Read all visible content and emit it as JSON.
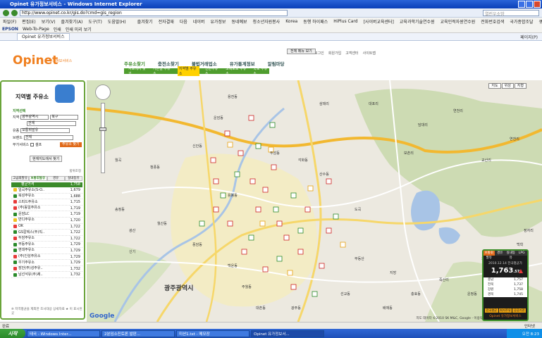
{
  "window": {
    "title": "Opinet 유가정보서비스 - Windows Internet Explorer"
  },
  "browser": {
    "url": "http://www.opinet.co.kr/gis.do?cmd=gis_region",
    "search_placeholder": "열린우소밤",
    "menu": [
      "파일(F)",
      "편집(E)",
      "보기(V)",
      "즐겨찾기(A)",
      "도구(T)",
      "도움말(H)"
    ],
    "favorites": [
      "즐겨찾기",
      "전자결재",
      "다음",
      "네이버",
      "유가정보",
      "동네예보",
      "청소년자원봉사",
      "Korea",
      "동행 하이패스",
      "HiPlus Card",
      "[사이버교육센터]",
      "교육과학기술연수원",
      "교육인적자원연수원",
      "전화번호검색",
      "국가종합조달",
      "큐빅",
      "GG",
      "엠피"
    ],
    "toolbar2": [
      "EPSON",
      "Web-To-Page",
      "인쇄",
      "인쇄 미리 보기"
    ],
    "tab_label": "Opinet 유가정보서비스",
    "tab_right": "페이지(P)"
  },
  "site": {
    "logo": "Opinet",
    "logo_sub": "유가정보서비스",
    "toplinks": [
      "로그인",
      "회원가입",
      "고객센터",
      "사이트맵"
    ],
    "allmenu": "전체 메뉴 보기",
    "gnb": [
      "주유소찾기",
      "충전소찾기",
      "불법거래업소",
      "유가통계정보",
      "알림마당"
    ],
    "lnb": [
      "지도에서 찾기",
      "가는길 주유소",
      "지역별 주유소",
      "인근주유소",
      "고속도로 주유소",
      "국도 주유소"
    ]
  },
  "sidebar": {
    "title": "지역별 주유소",
    "area_label": "지역선택",
    "region_label": "지역",
    "region_value": "광주광역시",
    "district_value": "북구",
    "dong_value": "전체",
    "fuel_label": "유종",
    "fuel_value": "보통휘발유",
    "brand_label": "브랜드",
    "brand_value": "전체",
    "extra_label": "부가서비스",
    "self_label": "셀프",
    "find_button": "주유소 찾기",
    "map_button": "현재지도에서 찾기",
    "range_note": "범위조정",
    "tabs": [
      "고급휘발유",
      "보통휘발유",
      "경유",
      "실내등유"
    ],
    "avg_label": "평균가격",
    "avg_value": "1,758",
    "stations": [
      {
        "name": "일곡주유소(S-O..",
        "price": "1,679",
        "color": "#f0c020"
      },
      {
        "name": "북성주유소",
        "price": "1,688",
        "color": "#2a8a2a"
      },
      {
        "name": "스피드주유소",
        "price": "1,715",
        "color": "#e83a3a"
      },
      {
        "name": "(주)동일주유소",
        "price": "1,719",
        "color": "#e83a3a"
      },
      {
        "name": "운암LC",
        "price": "1,719",
        "color": "#2a8a2a"
      },
      {
        "name": "반디주유소",
        "price": "1,720",
        "color": "#f0c020"
      },
      {
        "name": "OK",
        "price": "1,722",
        "color": "#e83a3a"
      },
      {
        "name": "GS칼텍스(주)직..",
        "price": "1,722",
        "color": "#2a8a2a"
      },
      {
        "name": "두암주유소",
        "price": "1,722",
        "color": "#e83a3a"
      },
      {
        "name": "무등주유소",
        "price": "1,729",
        "color": "#2a8a2a"
      },
      {
        "name": "현대주유소",
        "price": "1,729",
        "color": "#2a8a2a"
      },
      {
        "name": "(주)인성주유소",
        "price": "1,729",
        "color": "#e83a3a"
      },
      {
        "name": "우기주유소",
        "price": "1,729",
        "color": "#2a8a2a"
      },
      {
        "name": "장안(주)성주유..",
        "price": "1,732",
        "color": "#e83a3a"
      },
      {
        "name": "남선석유(주)제..",
        "price": "1,732",
        "color": "#2a8a2a"
      }
    ],
    "footnote": "※ 지역평균을 제외한 조사대상 상세자료 ★ 이 표시된 곳"
  },
  "map": {
    "maptypes": [
      "지도",
      "위성",
      "지형"
    ],
    "city_label": "광주광역시",
    "labels": [
      {
        "t": "삼태리"
      },
      {
        "t": "대포리"
      },
      {
        "t": "용전동"
      },
      {
        "t": "담대리"
      },
      {
        "t": "연천리"
      },
      {
        "t": "보촌리"
      },
      {
        "t": "교산리"
      },
      {
        "t": "운암동"
      },
      {
        "t": "신안동"
      },
      {
        "t": "각화동"
      },
      {
        "t": "산수동"
      },
      {
        "t": "두암동"
      },
      {
        "t": "풍암동"
      },
      {
        "t": "백운동"
      },
      {
        "t": "주월동"
      },
      {
        "t": "송정동"
      },
      {
        "t": "청풍동"
      },
      {
        "t": "광산"
      },
      {
        "t": "신기"
      },
      {
        "t": "월산동"
      },
      {
        "t": "용봉동"
      },
      {
        "t": "도곡"
      },
      {
        "t": "월곡"
      },
      {
        "t": "연천리"
      },
      {
        "t": "무등산"
      },
      {
        "t": "지방"
      },
      {
        "t": "충효동"
      },
      {
        "t": "운정동"
      },
      {
        "t": "광주동"
      },
      {
        "t": "배재동"
      },
      {
        "t": "선교동"
      },
      {
        "t": "대촌동"
      },
      {
        "t": "지석리"
      },
      {
        "t": "죽산리"
      },
      {
        "t": "정자리"
      },
      {
        "t": "백학"
      }
    ],
    "copyright": "지도 데이터 ©2010 SK M&C, Google - 이용약관",
    "google": "Google"
  },
  "pricebox": {
    "tabs": [
      "보통휘발유",
      "경유",
      "실내등유",
      "LPG"
    ],
    "date": "2010.12.14 전국평균가",
    "price": "1,763",
    "price_dec": ".57",
    "rows": [
      {
        "label": "충남",
        "value": "1,757"
      },
      {
        "label": "전북",
        "value": "1,737"
      },
      {
        "label": "강원",
        "value": "1,758"
      },
      {
        "label": "경북",
        "value": "1,745"
      }
    ],
    "btns": [
      "전국평균",
      "최저주유소",
      "공공기관"
    ],
    "brand": "Opinet 유가정보서비스"
  },
  "statusbar": {
    "left": "완료",
    "right": "인터넷"
  },
  "taskbar": {
    "start": "시작",
    "tasks": [
      "태국 - Windows Inter...",
      "2분임소진토론 발판...",
      "미션1.txt - 메모장",
      "Opinet 유가정보서..."
    ],
    "clock": "오전 8:23"
  }
}
